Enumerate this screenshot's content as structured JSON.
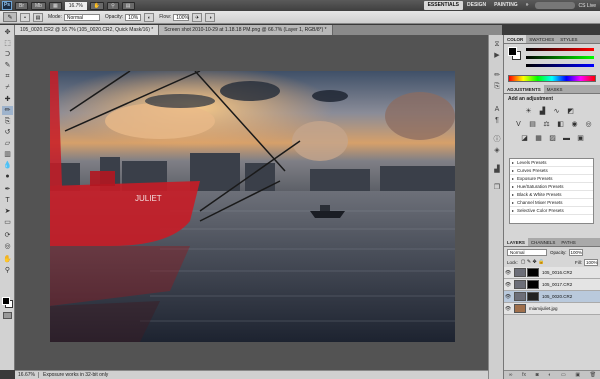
{
  "appbar": {
    "logo": "Ps",
    "zoom": "16.7%",
    "workspaces": [
      "ESSENTIALS",
      "DESIGN",
      "PAINTING",
      "»"
    ],
    "cs_live": "CS Live"
  },
  "options": {
    "mode_label": "Mode:",
    "mode_value": "Normal",
    "opacity_label": "Opacity:",
    "opacity_value": "10%",
    "flow_label": "Flow:",
    "flow_value": "100%"
  },
  "doc_tabs": [
    "105_0020.CR2 @ 16.7% (105_0020.CR2, Quick Mask/16) *",
    "Screen shot 2010-10-29 at 1.18.18 PM.png @ 66.7% (Layer 1, RGB/8*) *"
  ],
  "status": {
    "zoom": "16.67%",
    "message": "Exposure works in 32-bit only"
  },
  "color_panel": {
    "tabs": [
      "COLOR",
      "SWATCHES",
      "STYLES"
    ]
  },
  "adjustments": {
    "tabs": [
      "ADJUSTMENTS",
      "MASKS"
    ],
    "title": "Add an adjustment",
    "presets": [
      "Levels Presets",
      "Curves Presets",
      "Exposure Presets",
      "Hue/Saturation Presets",
      "Black & White Presets",
      "Channel Mixer Presets",
      "Selective Color Presets"
    ]
  },
  "layers": {
    "tabs": [
      "LAYERS",
      "CHANNELS",
      "PATHS"
    ],
    "blend": "Normal",
    "opacity_label": "Opacity:",
    "opacity": "100%",
    "lock_label": "Lock:",
    "fill_label": "Fill:",
    "fill": "100%",
    "items": [
      "105_0016.CR2",
      "105_0017.CR2",
      "105_0020.CR2",
      "miamijuliet.jpg"
    ]
  },
  "photo": {
    "hull_name": "JULIET"
  },
  "colors": {
    "accent": "#3b8fd9",
    "quick_mask": "#d8202a"
  },
  "icons": {
    "toolbar": [
      "move-tool",
      "marquee-tool",
      "lasso-tool",
      "quick-select-tool",
      "crop-tool",
      "eyedropper-tool",
      "healing-tool",
      "brush-tool",
      "clone-tool",
      "history-brush-tool",
      "eraser-tool",
      "gradient-tool",
      "blur-tool",
      "dodge-tool",
      "pen-tool",
      "type-tool",
      "path-select-tool",
      "shape-tool",
      "3d-rotate-tool",
      "3d-orbit-tool",
      "hand-tool",
      "zoom-tool"
    ]
  }
}
